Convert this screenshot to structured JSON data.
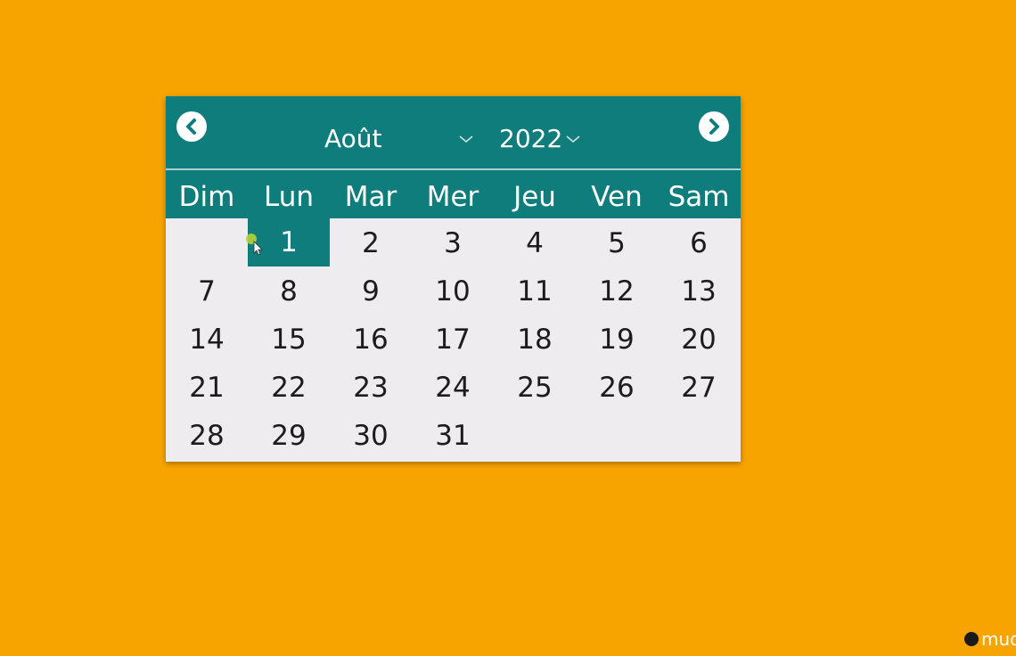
{
  "calendar": {
    "month": "Août",
    "year": "2022",
    "weekdays": [
      "Dim",
      "Lun",
      "Mar",
      "Mer",
      "Jeu",
      "Ven",
      "Sam"
    ],
    "weeks": [
      [
        "",
        "1",
        "2",
        "3",
        "4",
        "5",
        "6"
      ],
      [
        "7",
        "8",
        "9",
        "10",
        "11",
        "12",
        "13"
      ],
      [
        "14",
        "15",
        "16",
        "17",
        "18",
        "19",
        "20"
      ],
      [
        "21",
        "22",
        "23",
        "24",
        "25",
        "26",
        "27"
      ],
      [
        "28",
        "29",
        "30",
        "31",
        "",
        "",
        ""
      ]
    ],
    "selected_day": "1"
  },
  "colors": {
    "background": "#F8A400",
    "header": "#0E7D7C",
    "body": "#EEECEE",
    "selected": "#0E7D7C"
  },
  "icons": {
    "prev": "chevron-left-circle-icon",
    "next": "chevron-right-circle-icon",
    "dropdown": "chevron-down-icon"
  },
  "watermark": {
    "text": "mude"
  }
}
